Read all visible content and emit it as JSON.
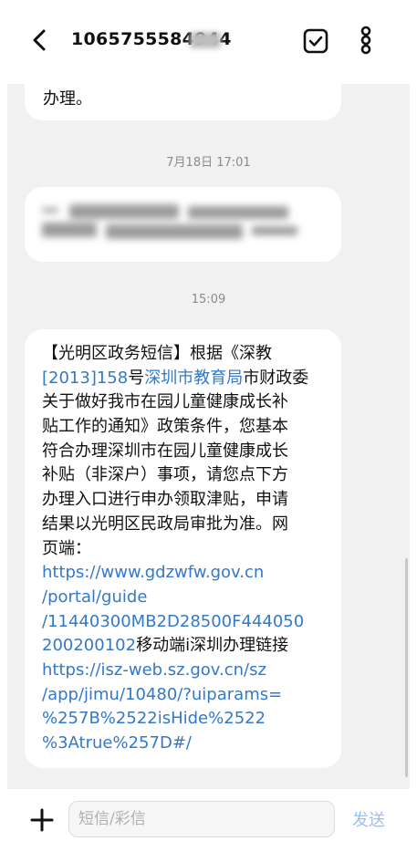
{
  "header": {
    "contact": "1065755584944"
  },
  "thread": {
    "prev_message_tail": "办理。",
    "timestamp_1": "7月18日 17:01",
    "timestamp_2": "15:09",
    "message_lines": [
      [
        {
          "t": "【光明区政务短信】根据《深教",
          "link": false
        }
      ],
      [
        {
          "t": "[2013]158",
          "link": true
        },
        {
          "t": "号",
          "link": false
        },
        {
          "t": "深圳市教育局",
          "link": true
        },
        {
          "t": "市财政委",
          "link": false
        }
      ],
      [
        {
          "t": "关于做好我市在园儿童健康成长补",
          "link": false
        }
      ],
      [
        {
          "t": "贴工作的通知》政策条件，您基本",
          "link": false
        }
      ],
      [
        {
          "t": "符合办理深圳市在园儿童健康成长",
          "link": false
        }
      ],
      [
        {
          "t": "补贴（非深户）事项，请您点下方",
          "link": false
        }
      ],
      [
        {
          "t": "办理入口进行申办领取津贴，申请",
          "link": false
        }
      ],
      [
        {
          "t": "结果以光明区民政局审批为准。网",
          "link": false
        }
      ],
      [
        {
          "t": "页端：",
          "link": false
        }
      ],
      [
        {
          "t": "https://www.gdzwfw.gov.cn",
          "link": true
        }
      ],
      [
        {
          "t": "/portal/guide",
          "link": true
        }
      ],
      [
        {
          "t": "/11440300MB2D28500F444050",
          "link": true
        }
      ],
      [
        {
          "t": "200200102",
          "link": true
        },
        {
          "t": "移动端i深圳办理链接",
          "link": false
        }
      ],
      [
        {
          "t": "https://isz-web.sz.gov.cn/sz",
          "link": true
        }
      ],
      [
        {
          "t": "/app/jimu/10480/?uiparams=",
          "link": true
        }
      ],
      [
        {
          "t": "%257B%2522isHide%2522",
          "link": true
        }
      ],
      [
        {
          "t": "%3Atrue%257D#/",
          "link": true
        }
      ]
    ]
  },
  "composer": {
    "placeholder": "短信/彩信",
    "send_label": "发送"
  },
  "icons": {
    "back": "arrow-left-icon",
    "select": "check-square-icon",
    "more": "more-vertical-icon",
    "add": "plus-icon"
  },
  "colors": {
    "link": "#3478c8",
    "send_disabled": "#9cc0ea",
    "thread_bg": "#f1f1f1"
  }
}
